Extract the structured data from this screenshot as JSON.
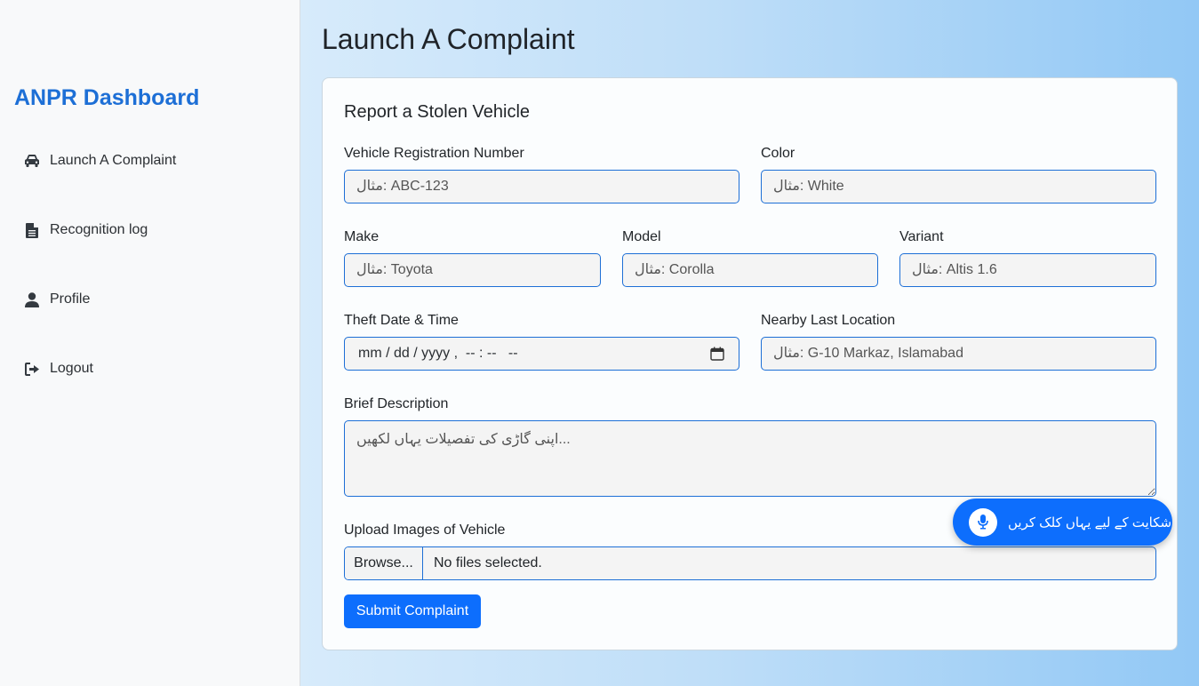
{
  "sidebar": {
    "brand": "ANPR Dashboard",
    "items": [
      {
        "label": "Launch A Complaint",
        "icon": "car-icon"
      },
      {
        "label": "Recognition log",
        "icon": "file-icon"
      },
      {
        "label": "Profile",
        "icon": "user-icon"
      },
      {
        "label": "Logout",
        "icon": "logout-icon"
      }
    ]
  },
  "page": {
    "title": "Launch A Complaint"
  },
  "form": {
    "title": "Report a Stolen Vehicle",
    "registration": {
      "label": "Vehicle Registration Number",
      "placeholder": "مثال: ABC-123"
    },
    "color": {
      "label": "Color",
      "placeholder": "مثال: White"
    },
    "make": {
      "label": "Make",
      "placeholder": "مثال: Toyota"
    },
    "model": {
      "label": "Model",
      "placeholder": "مثال: Corolla"
    },
    "variant": {
      "label": "Variant",
      "placeholder": "مثال: Altis 1.6"
    },
    "theft_datetime": {
      "label": "Theft Date & Time",
      "value": "mm / dd / yyyy ,  -- : --   --"
    },
    "location": {
      "label": "Nearby Last Location",
      "placeholder": "مثال: G-10 Markaz, Islamabad"
    },
    "description": {
      "label": "Brief Description",
      "placeholder": "اپنی گاڑی کی تفصیلات یہاں لکھیں..."
    },
    "upload": {
      "label": "Upload Images of Vehicle",
      "button": "Browse...",
      "status": "No files selected."
    },
    "submit_label": "Submit Complaint"
  },
  "voice_button": {
    "label": "شکایت کے لیے یہاں کلک کریں",
    "icon": "microphone-icon"
  },
  "colors": {
    "accent": "#0d6efd",
    "brand": "#1d6fd6",
    "sidebar_bg": "#f8f9fa"
  }
}
